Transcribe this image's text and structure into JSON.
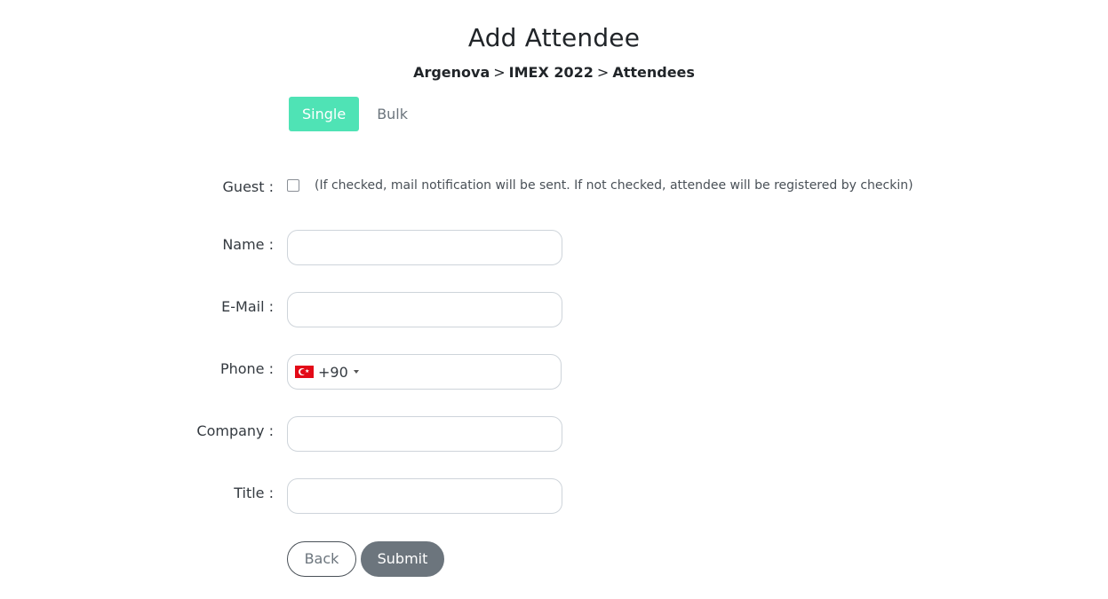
{
  "header": {
    "title": "Add Attendee",
    "breadcrumb": [
      "Argenova",
      "IMEX 2022",
      "Attendees"
    ],
    "separator": ">"
  },
  "tabs": [
    {
      "label": "Single",
      "active": true
    },
    {
      "label": "Bulk",
      "active": false
    }
  ],
  "form": {
    "guest": {
      "label": "Guest :",
      "checked": false,
      "hint": "(If checked, mail notification will be sent. If not checked, attendee will be registered by checkin)"
    },
    "name": {
      "label": "Name :",
      "value": ""
    },
    "email": {
      "label": "E-Mail :",
      "value": ""
    },
    "phone": {
      "label": "Phone :",
      "country": "TR",
      "flag_icon": "turkey-flag-icon",
      "dial_code": "+90",
      "value": ""
    },
    "company": {
      "label": "Company :",
      "value": ""
    },
    "title": {
      "label": "Title :",
      "value": ""
    }
  },
  "buttons": {
    "back": "Back",
    "submit": "Submit"
  },
  "colors": {
    "accent": "#4fe3b5",
    "submit_bg": "#6c757d",
    "flag_red": "#e30a17"
  }
}
